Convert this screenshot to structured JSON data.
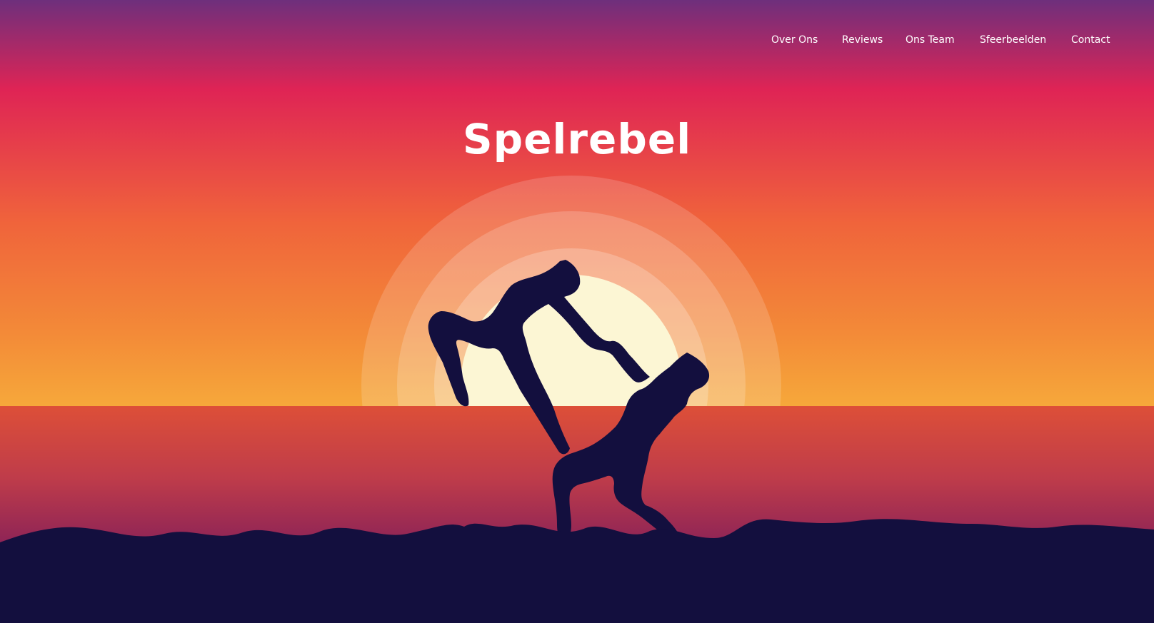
{
  "nav": {
    "items": [
      {
        "label": "Over Ons"
      },
      {
        "label": "Reviews"
      },
      {
        "label": "Ons Team"
      },
      {
        "label": "Sfeerbeelden"
      },
      {
        "label": "Contact"
      }
    ]
  },
  "hero": {
    "title": "Spelrebel",
    "illustration": "sunset-sea-dancers-silhouette"
  },
  "colors": {
    "sky_top": "#6f2e7c",
    "sky_pink": "#df2455",
    "sky_orange": "#f0673a",
    "horizon": "#f5a33a",
    "sun_core": "#fcf6d4",
    "sea_top": "#d94b39",
    "sea_bottom": "#8a2257",
    "silhouette": "#130f3e",
    "text": "#ffffff"
  }
}
